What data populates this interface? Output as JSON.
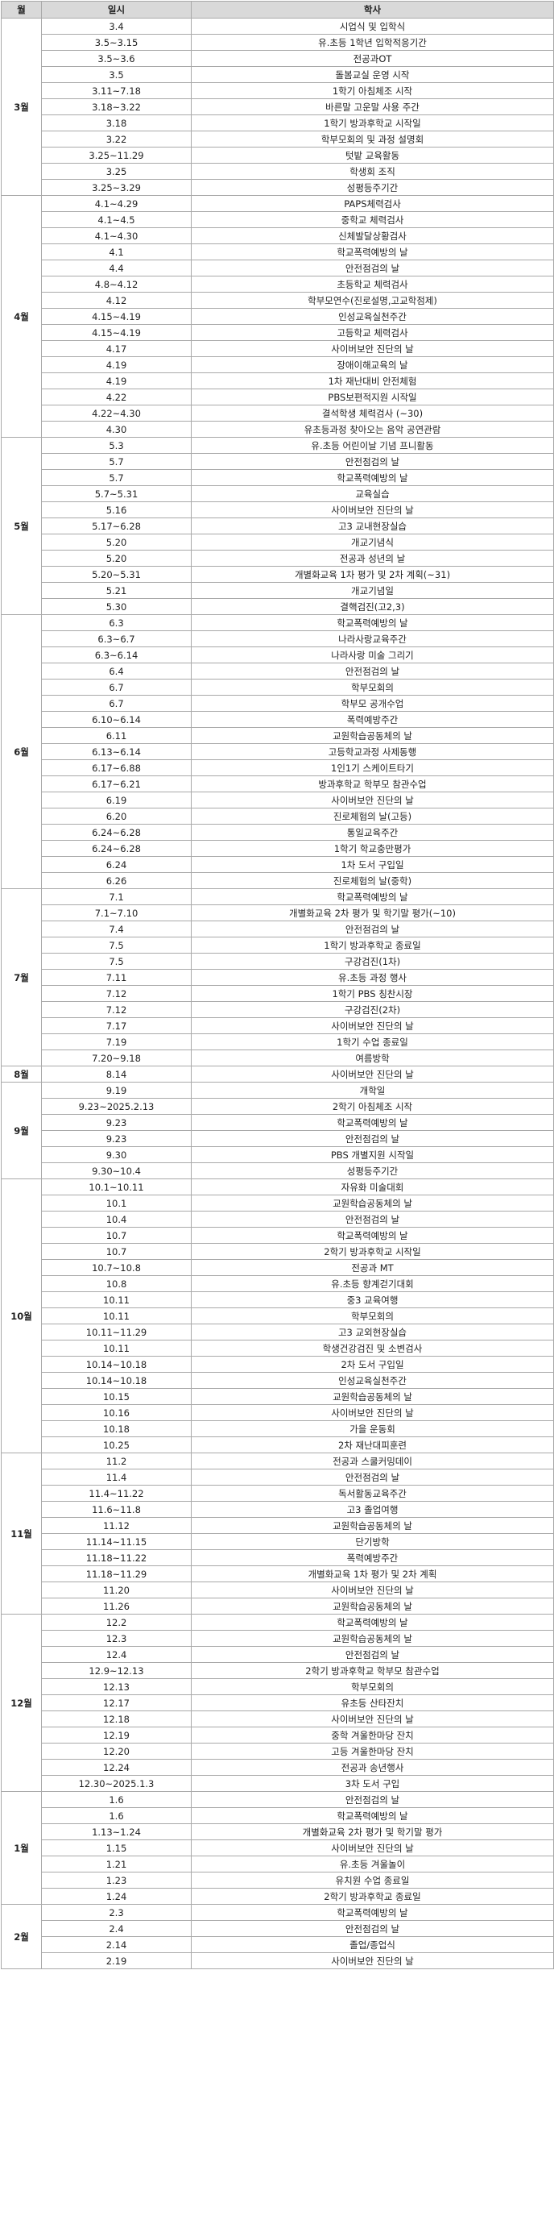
{
  "header": {
    "month": "월",
    "date": "일시",
    "event": "학사"
  },
  "months": [
    {
      "label": "3월",
      "rows": [
        [
          "3.4",
          "시업식 및 입학식"
        ],
        [
          "3.5~3.15",
          "유.초등 1학년 입학적응기간"
        ],
        [
          "3.5~3.6",
          "전공과OT"
        ],
        [
          "3.5",
          "돌봄교실 운영 시작"
        ],
        [
          "3.11~7.18",
          "1학기 아침체조 시작"
        ],
        [
          "3.18~3.22",
          "바른말 고운말 사용 주간"
        ],
        [
          "3.18",
          "1학기 방과후학교 시작일"
        ],
        [
          "3.22",
          "학부모회의 및 과정 설명회"
        ],
        [
          "3.25~11.29",
          "텃밭 교육활동"
        ],
        [
          "3.25",
          "학생회 조직"
        ],
        [
          "3.25~3.29",
          "성평등주기간"
        ]
      ]
    },
    {
      "label": "4월",
      "rows": [
        [
          "4.1~4.29",
          "PAPS체력검사"
        ],
        [
          "4.1~4.5",
          "중학교 체력검사"
        ],
        [
          "4.1~4.30",
          "신체발달상황검사"
        ],
        [
          "4.1",
          "학교폭력예방의 날"
        ],
        [
          "4.4",
          "안전점검의 날"
        ],
        [
          "4.8~4.12",
          "초등학교 체력검사"
        ],
        [
          "4.12",
          "학부모연수(진로설명,고교학점제)"
        ],
        [
          "4.15~4.19",
          "인성교육실천주간"
        ],
        [
          "4.15~4.19",
          "고등학교 체력검사"
        ],
        [
          "4.17",
          "사이버보안 진단의 날"
        ],
        [
          "4.19",
          "장애이해교육의 날"
        ],
        [
          "4.19",
          "1차 재난대비 안전체험"
        ],
        [
          "4.22",
          "PBS보편적지원 시작일"
        ],
        [
          "4.22~4.30",
          "결석학생 체력검사 (~30)"
        ],
        [
          "4.30",
          "유초등과정 찾아오는 음악 공연관람"
        ]
      ]
    },
    {
      "label": "5월",
      "rows": [
        [
          "5.3",
          "유.초등 어린이날 기념 프니활동"
        ],
        [
          "5.7",
          "안전점검의 날"
        ],
        [
          "5.7",
          "학교폭력예방의 날"
        ],
        [
          "5.7~5.31",
          "교육실습"
        ],
        [
          "5.16",
          "사이버보안 진단의 날"
        ],
        [
          "5.17~6.28",
          "고3 교내현장실습"
        ],
        [
          "5.20",
          "개교기념식"
        ],
        [
          "5.20",
          "전공과 성년의 날"
        ],
        [
          "5.20~5.31",
          "개별화교육 1차 평가 및 2차 계획(~31)"
        ],
        [
          "5.21",
          "개교기념일"
        ],
        [
          "5.30",
          "결핵검진(고2,3)"
        ]
      ]
    },
    {
      "label": "6월",
      "rows": [
        [
          "6.3",
          "학교폭력예방의 날"
        ],
        [
          "6.3~6.7",
          "나라사랑교육주간"
        ],
        [
          "6.3~6.14",
          "나라사랑 미술 그리기"
        ],
        [
          "6.4",
          "안전점검의 날"
        ],
        [
          "6.7",
          "학부모회의"
        ],
        [
          "6.7",
          "학부모 공개수업"
        ],
        [
          "6.10~6.14",
          "폭력예방주간"
        ],
        [
          "6.11",
          "교원학습공동체의 날"
        ],
        [
          "6.13~6.14",
          "고등학교과정 사제동행"
        ],
        [
          "6.17~6.88",
          "1인1기 스케이트타기"
        ],
        [
          "6.17~6.21",
          "방과후학교 학부모 참관수업"
        ],
        [
          "6.19",
          "사이버보안 진단의 날"
        ],
        [
          "6.20",
          "진로체험의 날(고등)"
        ],
        [
          "6.24~6.28",
          "통일교육주간"
        ],
        [
          "6.24~6.28",
          "1학기 학교충만평가"
        ],
        [
          "6.24",
          "1차 도서 구입일"
        ],
        [
          "6.26",
          "진로체험의 날(중학)"
        ]
      ]
    },
    {
      "label": "7월",
      "rows": [
        [
          "7.1",
          "학교폭력예방의 날"
        ],
        [
          "7.1~7.10",
          "개별화교육 2차 평가 및 학기말 평가(~10)"
        ],
        [
          "7.4",
          "안전점검의 날"
        ],
        [
          "7.5",
          "1학기 방과후학교 종료일"
        ],
        [
          "7.5",
          "구강검진(1차)"
        ],
        [
          "7.11",
          "유.초등 과정 행사"
        ],
        [
          "7.12",
          "1학기 PBS 칭찬시장"
        ],
        [
          "7.12",
          "구강검진(2차)"
        ],
        [
          "7.17",
          "사이버보안 진단의 날"
        ],
        [
          "7.19",
          "1학기 수업 종료일"
        ],
        [
          "7.20~9.18",
          "여름방학"
        ]
      ]
    },
    {
      "label": "8월",
      "rows": [
        [
          "8.14",
          "사이버보안 진단의 날"
        ]
      ]
    },
    {
      "label": "9월",
      "rows": [
        [
          "9.19",
          "개학일"
        ],
        [
          "9.23~2025.2.13",
          "2학기 아침체조 시작"
        ],
        [
          "9.23",
          "학교폭력예방의 날"
        ],
        [
          "9.23",
          "안전점검의 날"
        ],
        [
          "9.30",
          "PBS 개별지원 시작일"
        ],
        [
          "9.30~10.4",
          "성평등주기간"
        ]
      ]
    },
    {
      "label": "10월",
      "rows": [
        [
          "10.1~10.11",
          "자유화 미술대회"
        ],
        [
          "10.1",
          "교원학습공동체의 날"
        ],
        [
          "10.4",
          "안전점검의 날"
        ],
        [
          "10.7",
          "학교폭력예방의 날"
        ],
        [
          "10.7",
          "2학기 방과후학교 시작일"
        ],
        [
          "10.7~10.8",
          "전공과 MT"
        ],
        [
          "10.8",
          "유.초등 향계걷기대회"
        ],
        [
          "10.11",
          "중3 교육여행"
        ],
        [
          "10.11",
          "학부모회의"
        ],
        [
          "10.11~11.29",
          "고3 교외현장실습"
        ],
        [
          "10.11",
          "학생건강검진 및 소변검사"
        ],
        [
          "10.14~10.18",
          "2차 도서 구입일"
        ],
        [
          "10.14~10.18",
          "인성교육실천주간"
        ],
        [
          "10.15",
          "교원학습공동체의 날"
        ],
        [
          "10.16",
          "사이버보안 진단의 날"
        ],
        [
          "10.18",
          "가을 운동회"
        ],
        [
          "10.25",
          "2차 재난대피훈련"
        ]
      ]
    },
    {
      "label": "11월",
      "rows": [
        [
          "11.2",
          "전공과 스쿨커밍데이"
        ],
        [
          "11.4",
          "안전점검의 날"
        ],
        [
          "11.4~11.22",
          "독서활동교육주간"
        ],
        [
          "11.6~11.8",
          "고3 졸업여행"
        ],
        [
          "11.12",
          "교원학습공동체의 날"
        ],
        [
          "11.14~11.15",
          "단기방학"
        ],
        [
          "11.18~11.22",
          "폭력예방주간"
        ],
        [
          "11.18~11.29",
          "개별화교육 1차 평가 및 2차 계획"
        ],
        [
          "11.20",
          "사이버보안 진단의 날"
        ],
        [
          "11.26",
          "교원학습공동체의 날"
        ]
      ]
    },
    {
      "label": "12월",
      "rows": [
        [
          "12.2",
          "학교폭력예방의 날"
        ],
        [
          "12.3",
          "교원학습공동체의 날"
        ],
        [
          "12.4",
          "안전점검의 날"
        ],
        [
          "12.9~12.13",
          "2학기 방과후학교 학부모 참관수업"
        ],
        [
          "12.13",
          "학부모회의"
        ],
        [
          "12.17",
          "유초등 산타잔치"
        ],
        [
          "12.18",
          "사이버보안 진단의 날"
        ],
        [
          "12.19",
          "중학 겨울한마당 잔치"
        ],
        [
          "12.20",
          "고등 겨울한마당 잔치"
        ],
        [
          "12.24",
          "전공과 송년행사"
        ],
        [
          "12.30~2025.1.3",
          "3차 도서 구입"
        ]
      ]
    },
    {
      "label": "1월",
      "rows": [
        [
          "1.6",
          "안전점검의 날"
        ],
        [
          "1.6",
          "학교폭력예방의 날"
        ],
        [
          "1.13~1.24",
          "개별화교육 2차 평가 및 학기말 평가"
        ],
        [
          "1.15",
          "사이버보안 진단의 날"
        ],
        [
          "1.21",
          "유.초등 겨울놀이"
        ],
        [
          "1.23",
          "유치원 수업 종료일"
        ],
        [
          "1.24",
          "2학기 방과후학교 종료일"
        ]
      ]
    },
    {
      "label": "2월",
      "rows": [
        [
          "2.3",
          "학교폭력예방의 날"
        ],
        [
          "2.4",
          "안전점검의 날"
        ],
        [
          "2.14",
          "졸업/종업식"
        ],
        [
          "2.19",
          "사이버보안 진단의 날"
        ]
      ]
    }
  ]
}
